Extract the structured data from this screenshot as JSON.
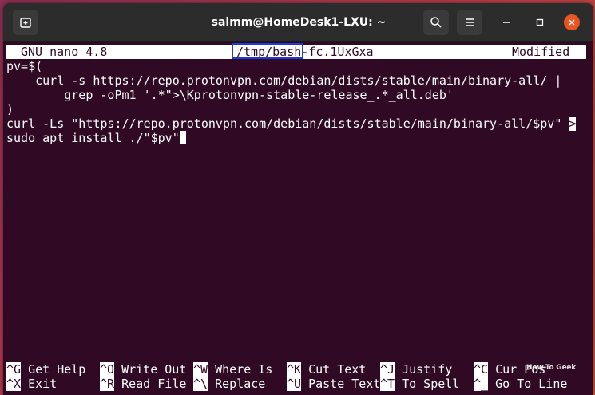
{
  "window": {
    "title": "salmm@HomeDesk1-LXU: ~"
  },
  "nano": {
    "version": "GNU nano 4.8",
    "filename_highlighted": "/tmp/bash",
    "filename_rest": "-fc.1UxGxa",
    "status": "Modified"
  },
  "editor": {
    "lines": [
      "pv=$(",
      "    curl -s https://repo.protonvpn.com/debian/dists/stable/main/binary-all/ |",
      "        grep -oPm1 '.*\">\\Kprotonvpn-stable-release_.*_all.deb'",
      ")",
      "curl -Ls \"https://repo.protonvpn.com/debian/dists/stable/main/binary-all/$pv\" >",
      "sudo apt install ./\"$pv\""
    ],
    "overflow_marker": ">"
  },
  "shortcuts": [
    {
      "key": "^G",
      "label": "Get Help"
    },
    {
      "key": "^O",
      "label": "Write Out"
    },
    {
      "key": "^W",
      "label": "Where Is"
    },
    {
      "key": "^K",
      "label": "Cut Text"
    },
    {
      "key": "^J",
      "label": "Justify"
    },
    {
      "key": "^C",
      "label": "Cur Pos"
    },
    {
      "key": "^X",
      "label": "Exit"
    },
    {
      "key": "^R",
      "label": "Read File"
    },
    {
      "key": "^\\",
      "label": "Replace"
    },
    {
      "key": "^U",
      "label": "Paste Text"
    },
    {
      "key": "^T",
      "label": "To Spell"
    },
    {
      "key": "^_",
      "label": "Go To Line"
    }
  ],
  "watermark": "How-To Geek",
  "colors": {
    "terminal_bg": "#300a24",
    "highlight_box": "#1f39d8",
    "close_button": "#e95420"
  }
}
